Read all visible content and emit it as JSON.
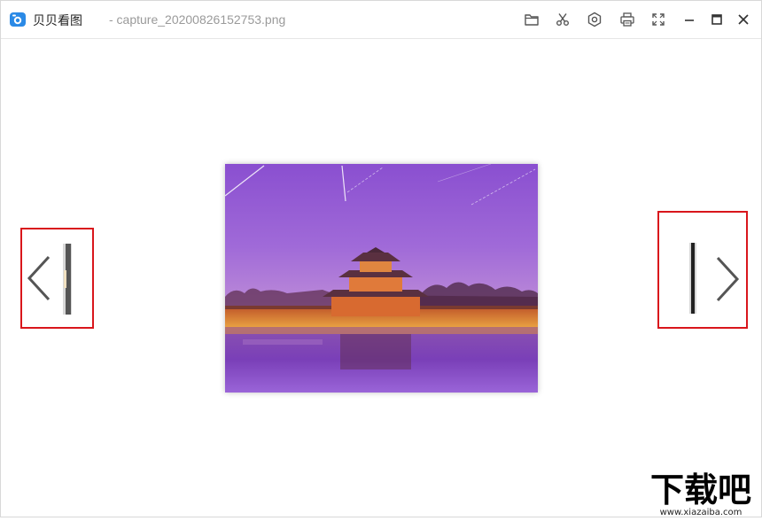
{
  "app": {
    "name": "贝贝看图",
    "file_title": "- capture_20200826152753.png"
  },
  "toolbar": [
    {
      "name": "open-folder",
      "icon": "folder-icon"
    },
    {
      "name": "crop",
      "icon": "scissors-icon"
    },
    {
      "name": "settings",
      "icon": "gear-icon"
    },
    {
      "name": "print",
      "icon": "printer-icon"
    },
    {
      "name": "fullscreen",
      "icon": "fullscreen-icon"
    },
    {
      "name": "minimize",
      "icon": "minimize-icon"
    },
    {
      "name": "maximize",
      "icon": "maximize-icon"
    },
    {
      "name": "close",
      "icon": "close-icon"
    }
  ],
  "navigation": {
    "prev_icon": "chevron-left-icon",
    "next_icon": "chevron-right-icon"
  },
  "colors": {
    "highlight_border": "#d9161c",
    "logo_blue": "#2b8ae6",
    "icon_gray": "#555555"
  },
  "watermark": {
    "text": "下载吧",
    "url": "www.xiazaiba.com"
  }
}
